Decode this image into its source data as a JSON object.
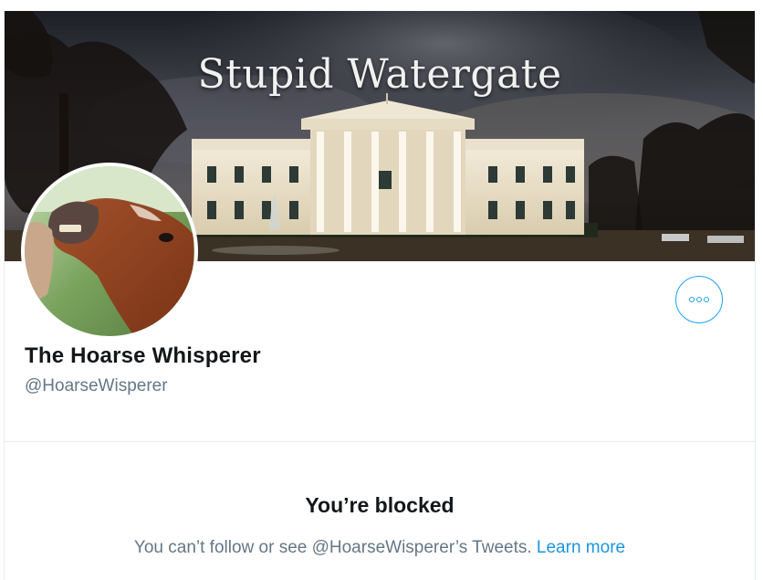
{
  "banner": {
    "title": "Stupid Watergate"
  },
  "profile": {
    "display_name": "The Hoarse Whisperer",
    "handle": "@HoarseWisperer",
    "avatar": "horse-avatar-image"
  },
  "actions": {
    "more_icon": "more-horizontal-icon"
  },
  "blocked": {
    "title": "You’re blocked",
    "message": "You can’t follow or see @HoarseWisperer’s Tweets.",
    "learn_more": "Learn more"
  },
  "colors": {
    "accent": "#1da1f2",
    "text_primary": "#14171a",
    "text_secondary": "#657786",
    "link": "#1b95e0",
    "border": "#e6ecf0"
  }
}
